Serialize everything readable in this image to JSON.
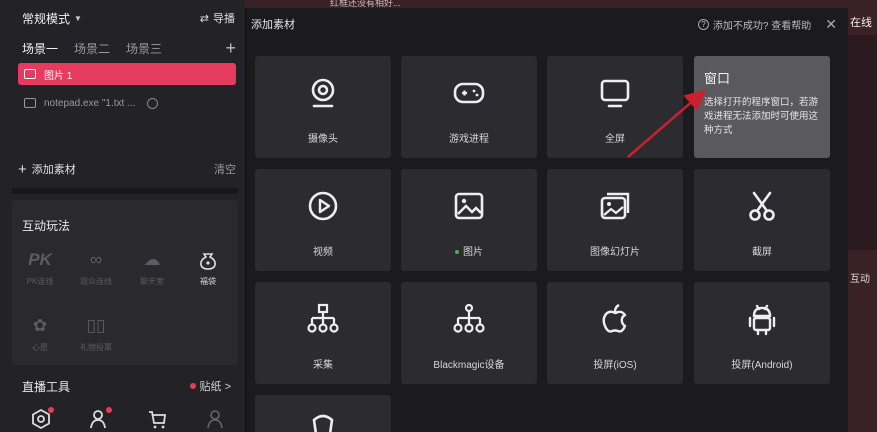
{
  "left": {
    "mode_label": "常规模式",
    "import_label": "导播",
    "scenes": [
      "场景一",
      "场景二",
      "场景三"
    ],
    "sources": [
      {
        "name": "图片 1"
      },
      {
        "name": "notepad.exe \"1.txt ..."
      }
    ],
    "add_source": "添加素材",
    "clear": "清空",
    "interact_title": "互动玩法",
    "interact_items": [
      {
        "label": "PK连线",
        "icon": "pk-icon"
      },
      {
        "label": "观众连线",
        "icon": "link-icon"
      },
      {
        "label": "聊天室",
        "icon": "chat-icon"
      },
      {
        "label": "福袋",
        "icon": "lucky-bag-icon"
      },
      {
        "label": "心愿",
        "icon": "wish-icon"
      },
      {
        "label": "礼物投票",
        "icon": "vote-icon"
      }
    ],
    "tools_title": "直播工具",
    "sticker_label": "贴纸 >"
  },
  "background": {
    "right_title": "在线",
    "right_sub": "互动",
    "top_text": "红框还没有相好..."
  },
  "dialog": {
    "title": "添加素材",
    "help_text": "添加不成功? 查看帮助",
    "cards": [
      {
        "label": "摄像头",
        "icon": "camera-icon"
      },
      {
        "label": "游戏进程",
        "icon": "gamepad-icon"
      },
      {
        "label": "全屏",
        "icon": "monitor-icon"
      },
      {
        "label": "窗口",
        "icon": "window-icon"
      },
      {
        "label": "视频",
        "icon": "play-icon"
      },
      {
        "label": "图片",
        "icon": "image-icon"
      },
      {
        "label": "图像幻灯片",
        "icon": "slideshow-icon"
      },
      {
        "label": "截屏",
        "icon": "scissors-icon"
      },
      {
        "label": "采集",
        "icon": "capture-icon"
      },
      {
        "label": "Blackmagic设备",
        "icon": "blackmagic-icon"
      },
      {
        "label": "投屏(iOS)",
        "icon": "apple-icon"
      },
      {
        "label": "投屏(Android)",
        "icon": "android-icon"
      }
    ],
    "tip": {
      "title": "窗口",
      "desc": "选择打开的程序窗口，若游戏进程无法添加时可使用这种方式"
    }
  },
  "colors": {
    "accent": "#e43b5e",
    "card": "#2c2c30",
    "tip_card": "#5a5a5e",
    "arrow": "#c8202e"
  }
}
